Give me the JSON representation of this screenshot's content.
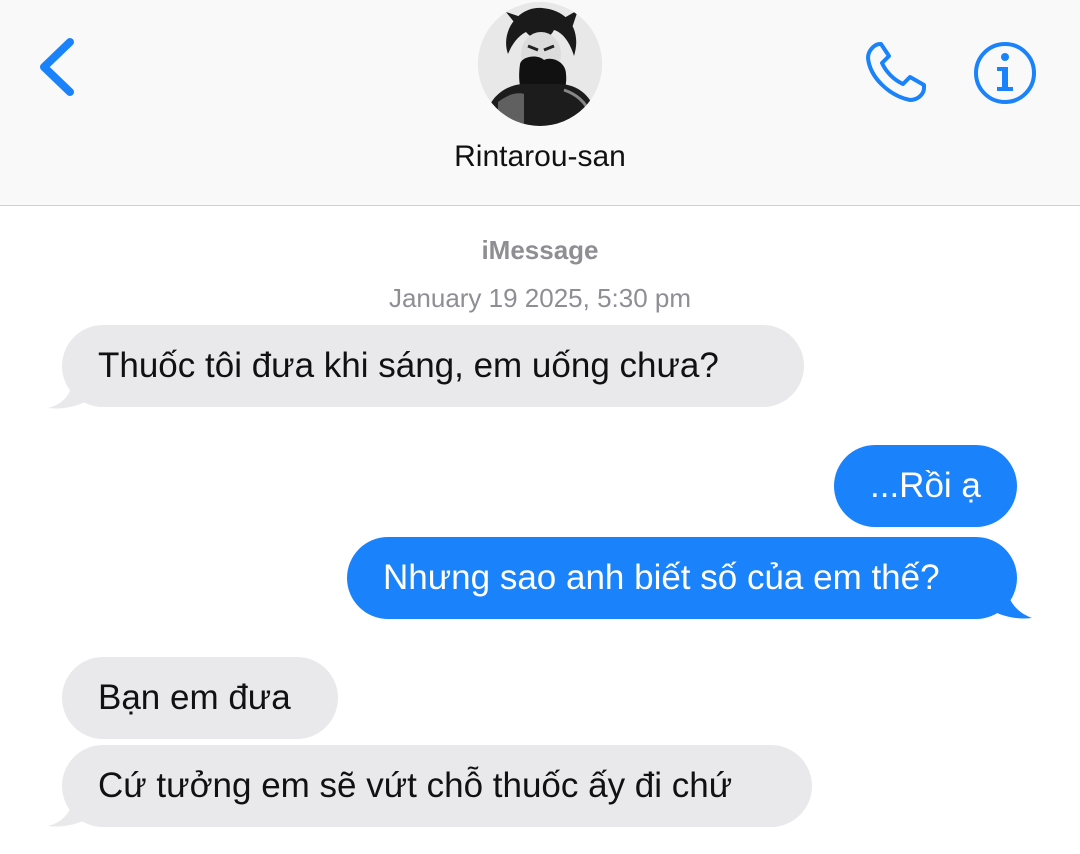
{
  "header": {
    "contact_name": "Rintarou-san",
    "back_icon": "chevron-left-icon",
    "call_icon": "phone-icon",
    "info_icon": "info-icon",
    "accent_color": "#1a82fb"
  },
  "conversation": {
    "service": "iMessage",
    "timestamp": "January 19 2025, 5:30 pm"
  },
  "messages": [
    {
      "direction": "received",
      "text": "Thuốc tôi đưa khi sáng, em uống chưa?"
    },
    {
      "direction": "sent",
      "text": "...Rồi ạ"
    },
    {
      "direction": "sent",
      "text": "Nhưng sao anh biết số của em thế?"
    },
    {
      "direction": "received",
      "text": "Bạn em đưa"
    },
    {
      "direction": "received",
      "text": "Cứ tưởng em sẽ vứt chỗ thuốc ấy đi chứ"
    }
  ],
  "colors": {
    "sent_bubble": "#1a82fb",
    "received_bubble": "#e9e9eb",
    "meta_text": "#8e8e93"
  }
}
